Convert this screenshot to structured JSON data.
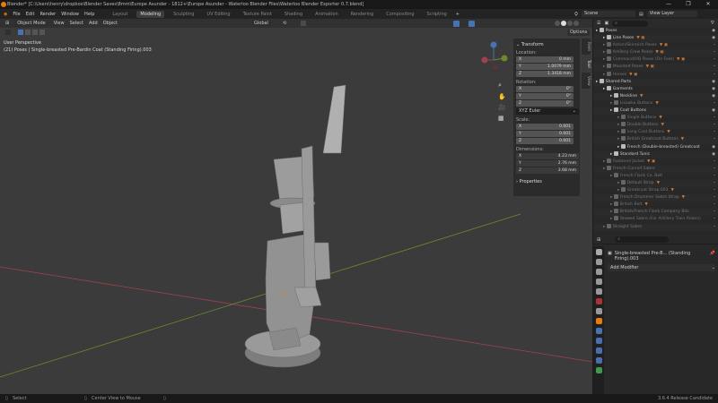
{
  "title": "Blender* [C:\\Users\\henry\\dropbox\\Blender Saves\\8mm\\Europe Asunder - 1812+\\Europe Asunder - Waterloo Blender Files\\Waterloo Blender Exporter 0.7.blend]",
  "menu": [
    "File",
    "Edit",
    "Render",
    "Window",
    "Help"
  ],
  "workspaces": [
    "Layout",
    "Modeling",
    "Sculpting",
    "UV Editing",
    "Texture Paint",
    "Shading",
    "Animation",
    "Rendering",
    "Compositing",
    "Scripting"
  ],
  "active_workspace": "Modeling",
  "scene": "Scene",
  "view_layer": "View Layer",
  "viewport": {
    "mode": "Object Mode",
    "menus": [
      "View",
      "Select",
      "Add",
      "Object"
    ],
    "orientation": "Global",
    "options": "Options",
    "perspective": "User Perspective",
    "object_info": "(21) Poses | Single-breasted Pre-Bardin Coat (Standing Firing).003"
  },
  "npanel": {
    "tabs": [
      "Item",
      "Tool",
      "View"
    ],
    "transform": "Transform",
    "location_label": "Location:",
    "location": [
      [
        "X",
        "0 mm"
      ],
      [
        "Y",
        "1.0079 mm"
      ],
      [
        "Z",
        "1.3418 mm"
      ]
    ],
    "rotation_label": "Rotation:",
    "rotation": [
      [
        "X",
        "0°"
      ],
      [
        "Y",
        "0°"
      ],
      [
        "Z",
        "0°"
      ]
    ],
    "rotation_mode": "XYZ Euler",
    "scale_label": "Scale:",
    "scale": [
      [
        "X",
        "0.001"
      ],
      [
        "Y",
        "0.001"
      ],
      [
        "Z",
        "0.001"
      ]
    ],
    "dimensions_label": "Dimensions:",
    "dimensions": [
      [
        "X",
        "4.23 mm"
      ],
      [
        "Y",
        "2.76 mm"
      ],
      [
        "Z",
        "3.68 mm"
      ]
    ],
    "properties": "Properties"
  },
  "outliner": [
    {
      "label": "Poses",
      "depth": 0,
      "dim": false
    },
    {
      "label": "Line Poses",
      "depth": 1,
      "dim": false,
      "tag": "▼ ▣"
    },
    {
      "label": "Action/Skirmish Poses",
      "depth": 1,
      "dim": true,
      "tag": "▼ ▣"
    },
    {
      "label": "Artillery Crew Poses",
      "depth": 1,
      "dim": true,
      "tag": "▼ ▣"
    },
    {
      "label": "Command/HQ Poses (On Foot)",
      "depth": 1,
      "dim": true,
      "tag": "▼ ▣"
    },
    {
      "label": "Mounted Poses",
      "depth": 1,
      "dim": true,
      "tag": "▼ ▣"
    },
    {
      "label": "Horses",
      "depth": 1,
      "dim": true,
      "tag": "▼ ▣"
    },
    {
      "label": "Shared Parts",
      "depth": 0,
      "dim": false
    },
    {
      "label": "Garments",
      "depth": 1,
      "dim": false
    },
    {
      "label": "Neckline",
      "depth": 2,
      "dim": false,
      "tag": "▼"
    },
    {
      "label": "Lisowka Buttons",
      "depth": 2,
      "dim": true,
      "tag": "▼"
    },
    {
      "label": "Coat Buttons",
      "depth": 2,
      "dim": false
    },
    {
      "label": "Single Buttons",
      "depth": 3,
      "dim": true,
      "tag": "▼"
    },
    {
      "label": "Double Buttons",
      "depth": 3,
      "dim": true,
      "tag": "▼"
    },
    {
      "label": "Long Coat Buttons",
      "depth": 3,
      "dim": true,
      "tag": "▼"
    },
    {
      "label": "British Greatcoat Buttons",
      "depth": 3,
      "dim": true,
      "tag": "▼"
    },
    {
      "label": "French (Double-breasted) Greatcoat",
      "depth": 3,
      "dim": false
    },
    {
      "label": "Standard Tunic",
      "depth": 2,
      "dim": false
    },
    {
      "label": "Fastened Jacket",
      "depth": 1,
      "dim": true,
      "tag": "▼ ▣"
    },
    {
      "label": "French Curved Sabre",
      "depth": 1,
      "dim": true
    },
    {
      "label": "French Flank Co. Belt",
      "depth": 2,
      "dim": true
    },
    {
      "label": "Default Strap",
      "depth": 3,
      "dim": true,
      "tag": "▼"
    },
    {
      "label": "Greatcoat Strap.003",
      "depth": 3,
      "dim": true,
      "tag": "▼"
    },
    {
      "label": "French Drummer Sabre Strap",
      "depth": 2,
      "dim": true,
      "tag": "▼"
    },
    {
      "label": "British Belt",
      "depth": 2,
      "dim": true,
      "tag": "▼"
    },
    {
      "label": "British/French Flank Company Bits",
      "depth": 2,
      "dim": true
    },
    {
      "label": "Stowed Sabre (For Artillery Train Riders)",
      "depth": 2,
      "dim": true
    },
    {
      "label": "Straight Sabre",
      "depth": 1,
      "dim": true
    }
  ],
  "properties": {
    "object_name": "Single-breasted Pre-B... (Standing Firing).003",
    "add_modifier": "Add Modifier"
  },
  "status": {
    "select": "Select",
    "center": "Center View to Mouse",
    "version": "3.6.4 Release Candidate"
  },
  "colors": {
    "accent": "#4772b3",
    "x_axis": "#a2404c",
    "y_axis": "#6e8a2c",
    "orange": "#e87d0d"
  }
}
